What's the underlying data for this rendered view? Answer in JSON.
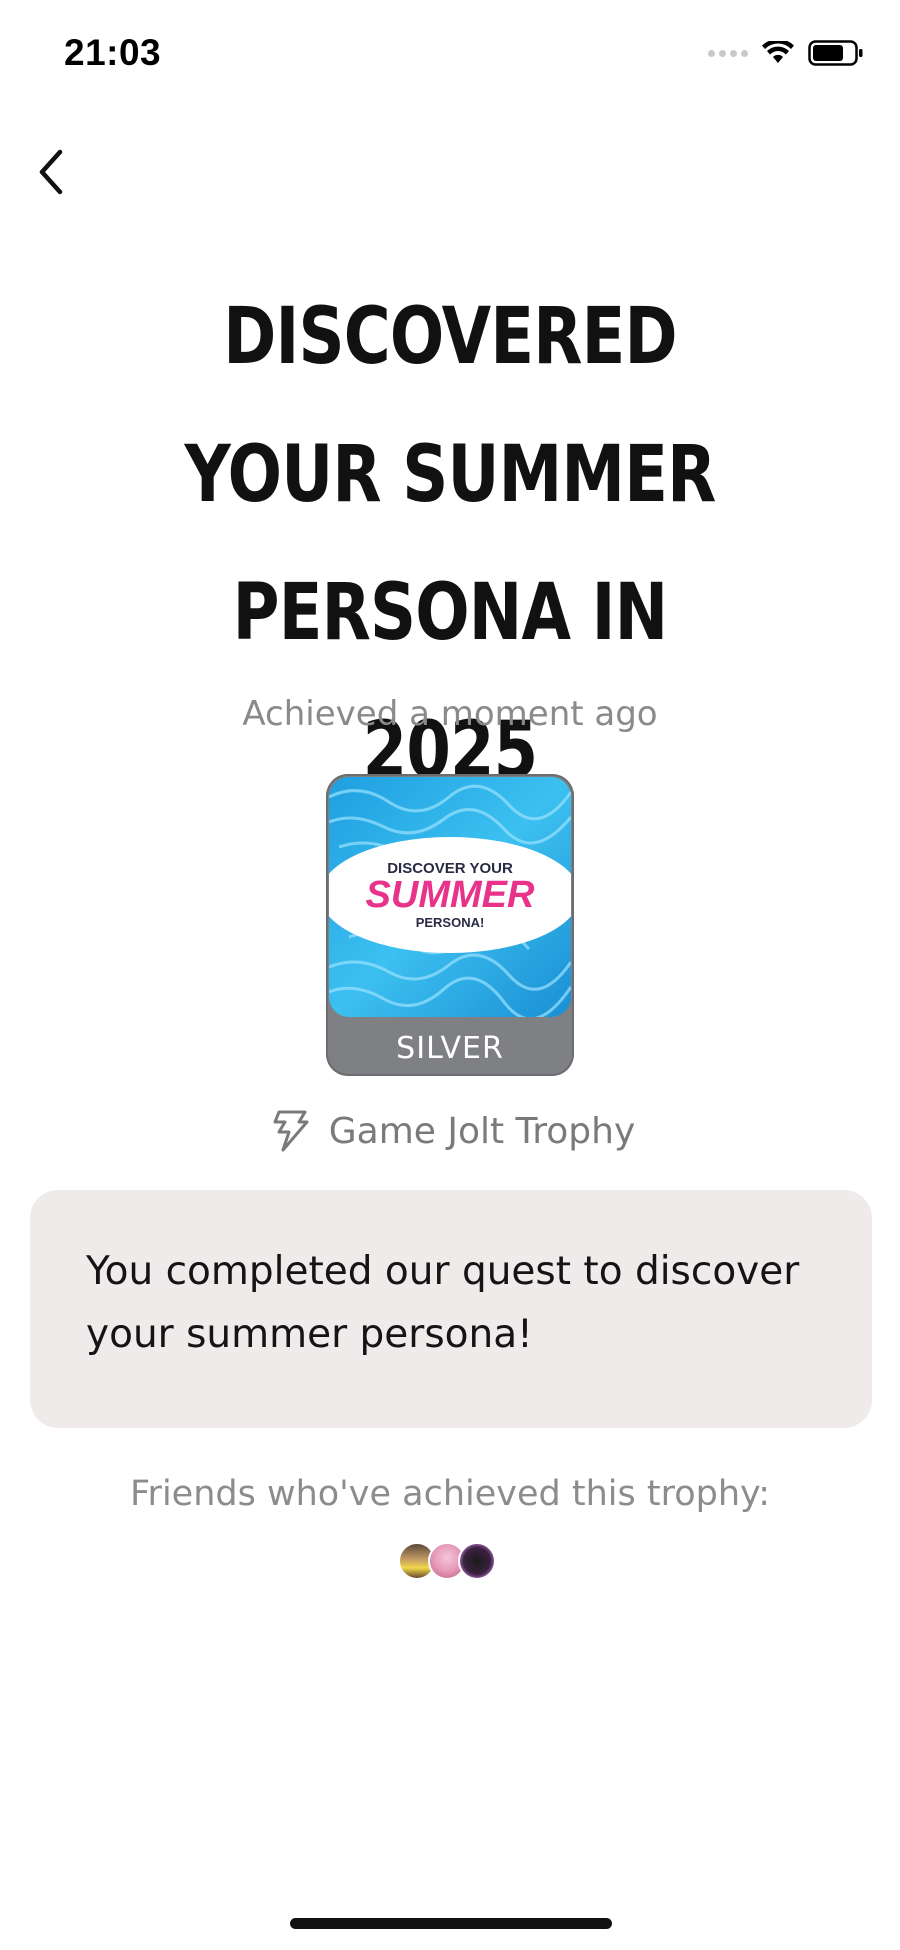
{
  "status_bar": {
    "time": "21:03"
  },
  "trophy": {
    "title": "DISCOVERED YOUR SUMMER PERSONA IN 2025",
    "achieved_text": "Achieved a moment ago",
    "image_text": {
      "line1": "DISCOVER YOUR",
      "line2": "SUMMER",
      "line3": "PERSONA!"
    },
    "tier": "SILVER",
    "tier_color": "#7f8083",
    "type_label": "Game Jolt Trophy",
    "type_icon": "game-jolt-bolt-icon",
    "description": "You completed our quest to discover your summer persona!"
  },
  "friends": {
    "label": "Friends who've achieved this trophy:",
    "avatars": [
      "friend-avatar-1",
      "friend-avatar-2",
      "friend-avatar-3"
    ]
  },
  "colors": {
    "background": "#ffffff",
    "description_bg": "#efebeb",
    "muted_text": "#8a8a8a",
    "water_blue": "#2bb0e8",
    "summer_pink": "#e8338a"
  }
}
